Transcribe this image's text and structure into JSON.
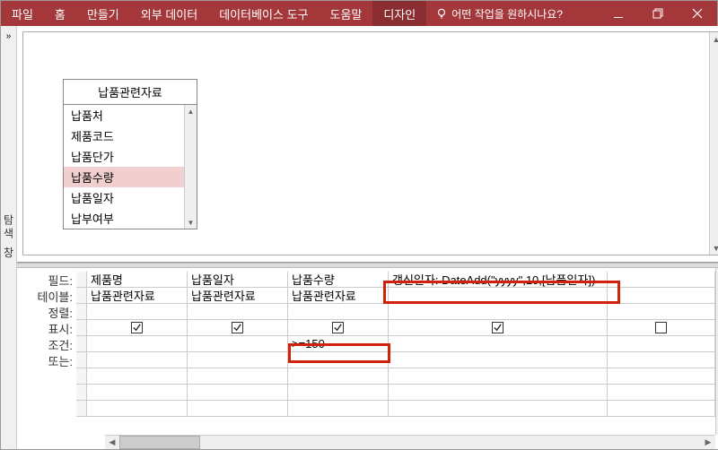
{
  "menubar": {
    "items": [
      "파일",
      "홈",
      "만들기",
      "외부 데이터",
      "데이터베이스 도구",
      "도움말",
      "디자인"
    ],
    "active_index": 6,
    "tell_me": "어떤 작업을 원하시나요?"
  },
  "left_panel": {
    "expand_glyph": "»",
    "vertical_label": "탐색 창"
  },
  "table_box": {
    "title": "납품관련자료",
    "fields": [
      "납품처",
      "제품코드",
      "납품단가",
      "납품수량",
      "납품일자",
      "납부여부"
    ],
    "selected_index": 3
  },
  "grid": {
    "row_labels": [
      "필드:",
      "테이블:",
      "정렬:",
      "표시:",
      "조건:",
      "또는:"
    ],
    "columns": [
      {
        "field": "제품명",
        "table": "납품관련자료",
        "sort": "",
        "show": true,
        "criteria": "",
        "or": ""
      },
      {
        "field": "납품일자",
        "table": "납품관련자료",
        "sort": "",
        "show": true,
        "criteria": "",
        "or": ""
      },
      {
        "field": "납품수량",
        "table": "납품관련자료",
        "sort": "",
        "show": true,
        "criteria": ">=150",
        "or": ""
      },
      {
        "field": "갱신일자: DateAdd(\"yyyy\",10,[납품일자])",
        "table": "",
        "sort": "",
        "show": true,
        "criteria": "",
        "or": ""
      },
      {
        "field": "",
        "table": "",
        "sort": "",
        "show": false,
        "criteria": "",
        "or": ""
      }
    ]
  }
}
